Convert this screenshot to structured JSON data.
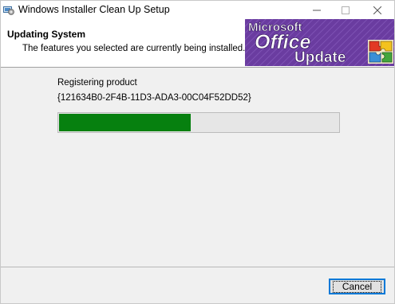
{
  "window": {
    "title": "Windows Installer Clean Up Setup",
    "app_icon": "installer-icon",
    "controls": [
      "minimize-icon",
      "maximize-icon",
      "close-icon"
    ]
  },
  "header": {
    "title": "Updating System",
    "description": "The features you selected are currently being installed.",
    "banner": {
      "line1": "Microsoft",
      "line2": "Office",
      "line3": "Update",
      "icon": "puzzle-pieces-icon"
    }
  },
  "main": {
    "status_label": "Registering product",
    "product_code": "{121634B0-2F4B-11D3-ADA3-00C04F52DD52}",
    "progress_fraction": 0.47,
    "progress_color": "#06800f"
  },
  "footer": {
    "cancel_label": "Cancel"
  }
}
